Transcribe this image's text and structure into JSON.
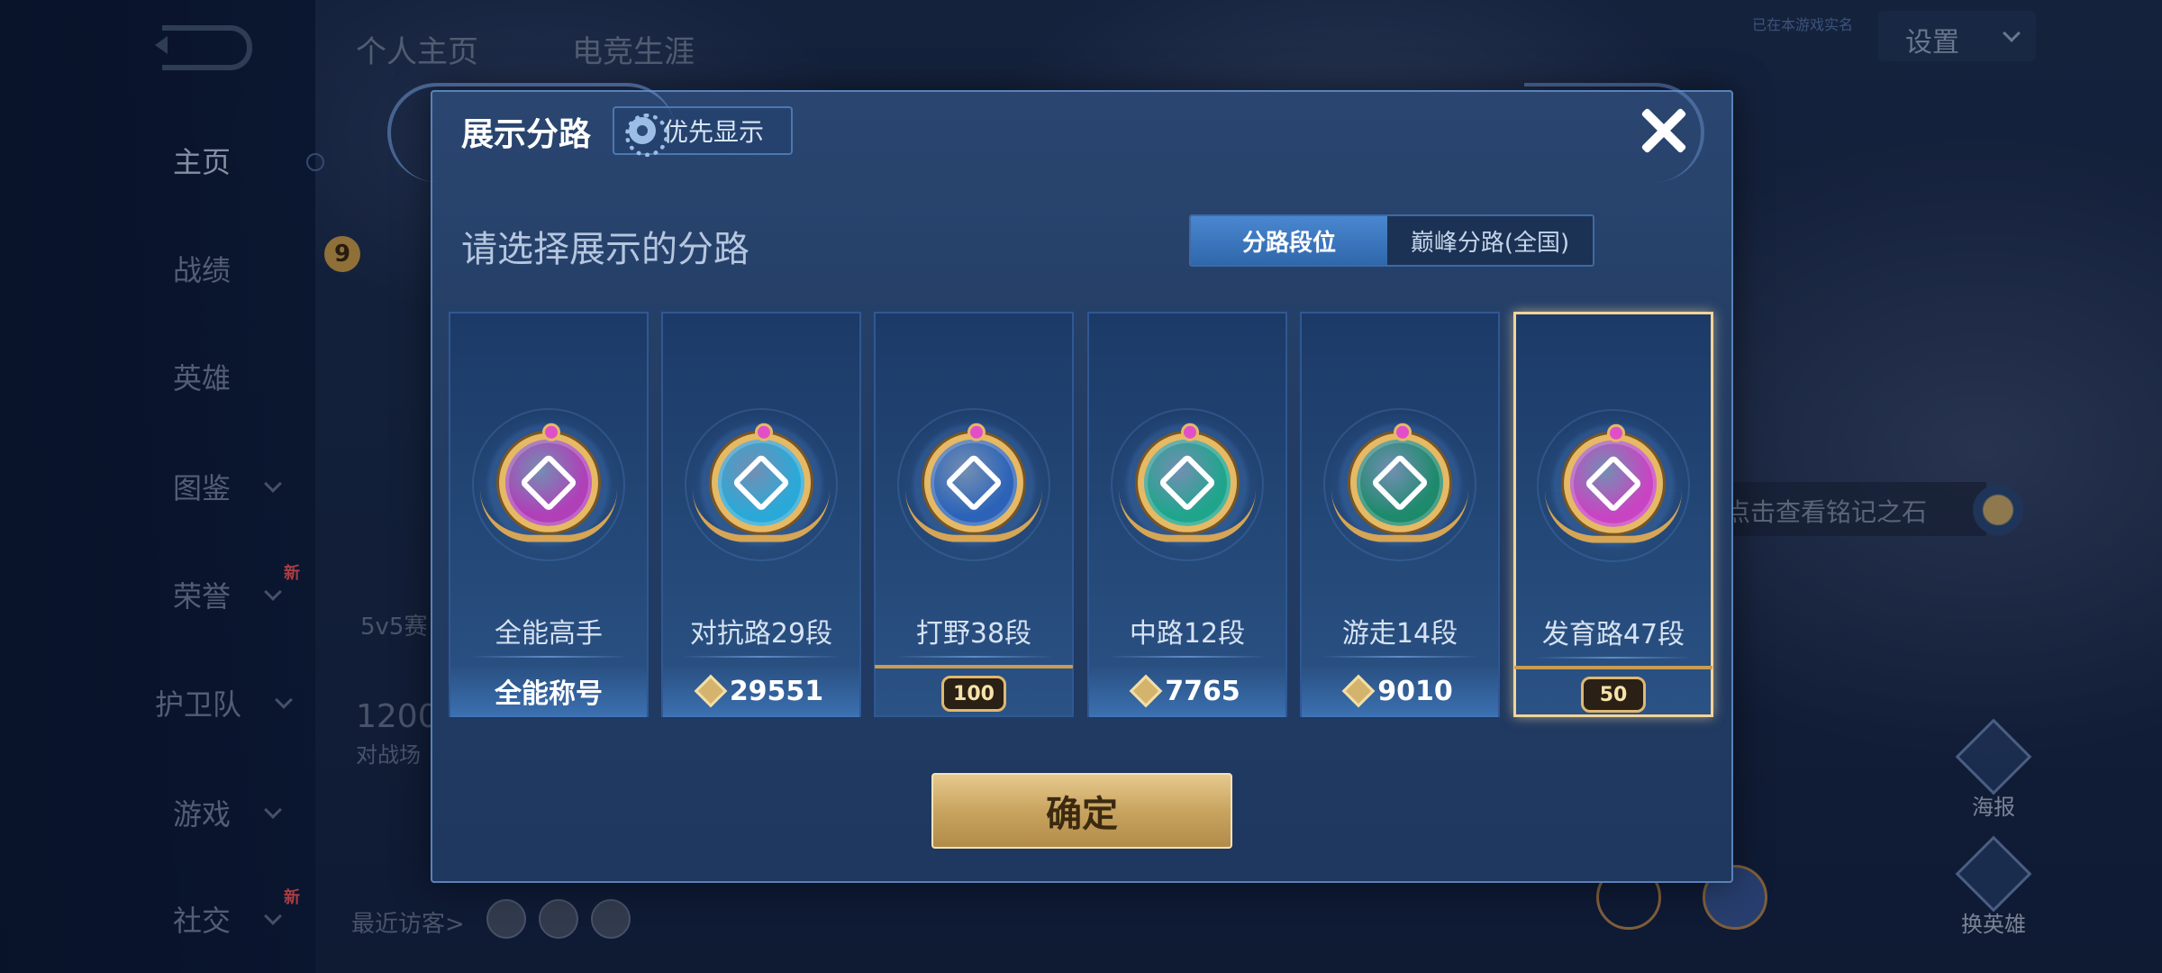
{
  "background": {
    "top_tabs": [
      "个人主页",
      "电竞生涯"
    ],
    "settings_label": "设置",
    "small_top_text": "已在本游戏实名",
    "sidebar_items": [
      {
        "label": "主页",
        "chevron": false,
        "new": false
      },
      {
        "label": "战绩",
        "chevron": false,
        "new": false
      },
      {
        "label": "英雄",
        "chevron": false,
        "new": false
      },
      {
        "label": "图鉴",
        "chevron": true,
        "new": false
      },
      {
        "label": "荣誉",
        "chevron": true,
        "new": true
      },
      {
        "label": "护卫队",
        "chevron": true,
        "new": false
      },
      {
        "label": "游戏",
        "chevron": true,
        "new": false
      },
      {
        "label": "社交",
        "chevron": true,
        "new": true
      }
    ],
    "new_badge": "新",
    "level_badge": "9",
    "mode_text": "5v5赛",
    "points_text": "1200",
    "match_text": "对战场",
    "recent_visitors": "最近访客>",
    "stone_label": "点击查看铭记之石",
    "right_buttons": [
      "海报",
      "换英雄"
    ]
  },
  "modal": {
    "title": "展示分路",
    "priority_button": "优先显示",
    "section_title": "请选择展示的分路",
    "segments": [
      "分路段位",
      "巅峰分路(全国)"
    ],
    "active_segment": 0,
    "cards": [
      {
        "name": "全能高手",
        "footer": "全能称号",
        "footer_type": "text",
        "emblem_color": "#b03fb8",
        "selected": false
      },
      {
        "name": "对抗路29段",
        "footer": "29551",
        "footer_type": "score",
        "emblem_color": "#2aa9d8",
        "selected": false
      },
      {
        "name": "打野38段",
        "footer": "100",
        "footer_type": "level",
        "emblem_color": "#2c63b8",
        "selected": false
      },
      {
        "name": "中路12段",
        "footer": "7765",
        "footer_type": "score",
        "emblem_color": "#1fa58c",
        "selected": false
      },
      {
        "name": "游走14段",
        "footer": "9010",
        "footer_type": "score",
        "emblem_color": "#1d8a6c",
        "selected": false
      },
      {
        "name": "发育路47段",
        "footer": "50",
        "footer_type": "level",
        "emblem_color": "#c944c2",
        "selected": true
      }
    ],
    "confirm_button": "确定",
    "colors": {
      "accent": "#4a87d0",
      "gold": "#e6c98e",
      "selected_border": "#f2d49a"
    }
  }
}
